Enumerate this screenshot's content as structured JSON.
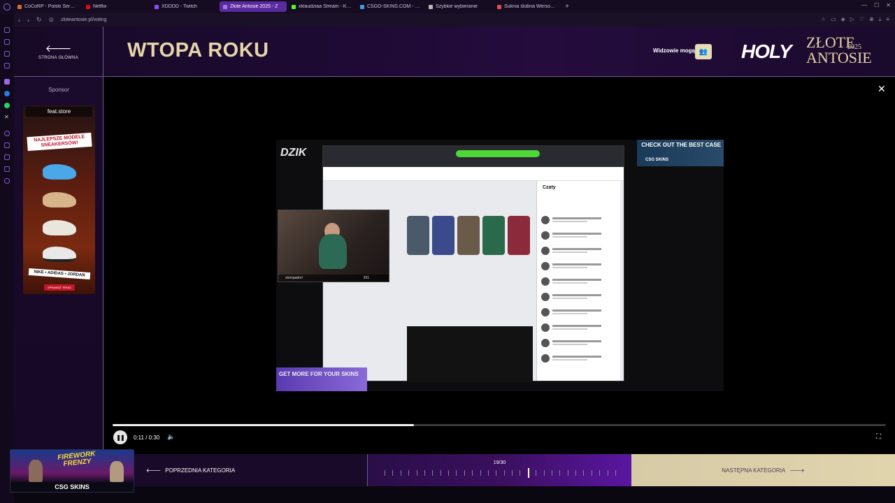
{
  "browser": {
    "tabs": [
      {
        "label": "CoCoRP - Polski Serwer G",
        "color": "#d96a2a",
        "active": false
      },
      {
        "label": "Netflix",
        "color": "#e50914",
        "active": false
      },
      {
        "label": "XDDDD - Twitch",
        "color": "#9146ff",
        "active": false
      },
      {
        "label": "Złote Antosie 2025 - Z",
        "color": "#a07ae0",
        "active": true
      },
      {
        "label": "xklaudziaa Stream - Kick",
        "color": "#53fc18",
        "active": false
      },
      {
        "label": "CSGO-SKINS.COM - Najle",
        "color": "#3aa0e0",
        "active": false
      },
      {
        "label": "Szybkie wybieranie",
        "color": "#bbbbbb",
        "active": false
      },
      {
        "label": "Suknia ślubna Wersow #!",
        "color": "#e05050",
        "active": false
      }
    ],
    "new_tab": "+",
    "url": "zloteantosie.pl/voting"
  },
  "header": {
    "home_label": "STRONA GŁÓWNA",
    "category_title": "WTOPA ROKU",
    "viewers_label": "Widzowie mogą",
    "brand": {
      "holy": "HOLY",
      "zlote": "ZŁOTE",
      "year": "2025",
      "antosie": "ANTOSIE"
    }
  },
  "sidebar": {
    "title": "Sponsor",
    "ad": {
      "store": "feat.store",
      "headline": "NAJLEPSZE MODELE SNEAKERSÓW!",
      "brands": "NIKE • ADIDAS • JORDAN",
      "cta": "SPRAWDŹ TERAZ"
    }
  },
  "video": {
    "overlay_logo": "DZIK",
    "cam_name": "stompadre!",
    "cam_count": "391",
    "chat_title": "Czaty",
    "sponsor_banner": "CHECK OUT THE BEST CASE",
    "sponsor_banner_logo": "CSG SKINS",
    "get_more": "GET MORE FOR YOUR SKINS",
    "current_time": "0:11",
    "duration": "0:30",
    "timer_text": "0:11 / 0:30",
    "progress": 0.39
  },
  "nav": {
    "prev_label": "POPRZEDNIA KATEGORIA",
    "next_label": "NASTĘPNA KATEGORIA",
    "counter": "19/30",
    "current": 19,
    "total": 30
  },
  "promo": {
    "title": "FIREWORK FRENZY",
    "brand": "CSG SKINS"
  },
  "colors": {
    "gold": "#e6d5a8",
    "purple_bg": "#1d0a33",
    "accent_purple": "#5a16a0"
  }
}
